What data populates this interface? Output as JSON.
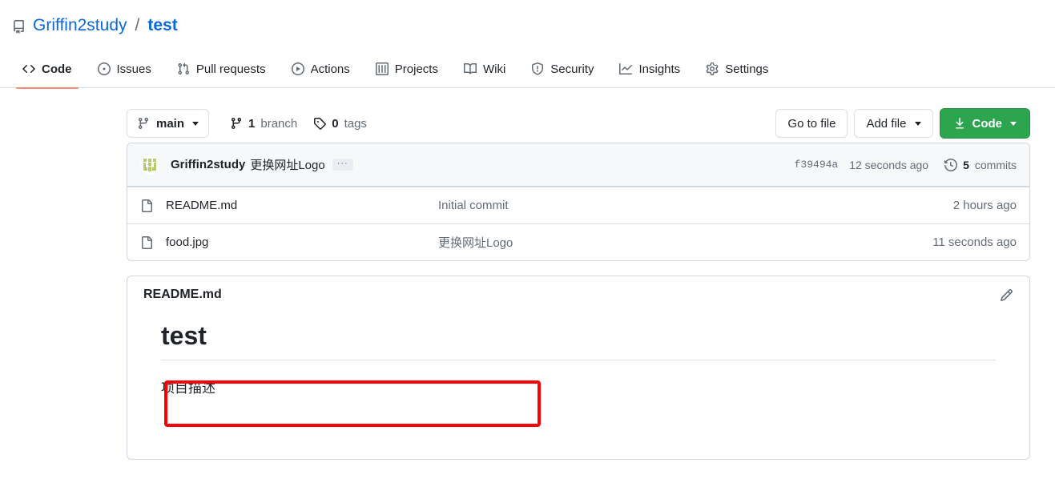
{
  "repo": {
    "icon": "repo-icon",
    "owner": "Griffin2study",
    "separator": "/",
    "name": "test"
  },
  "nav": {
    "tabs": [
      {
        "label": "Code",
        "icon": "code-icon",
        "active": true
      },
      {
        "label": "Issues",
        "icon": "issue-opened-icon",
        "active": false
      },
      {
        "label": "Pull requests",
        "icon": "git-pull-request-icon",
        "active": false
      },
      {
        "label": "Actions",
        "icon": "play-icon",
        "active": false
      },
      {
        "label": "Projects",
        "icon": "table-icon",
        "active": false
      },
      {
        "label": "Wiki",
        "icon": "book-icon",
        "active": false
      },
      {
        "label": "Security",
        "icon": "shield-icon",
        "active": false
      },
      {
        "label": "Insights",
        "icon": "graph-icon",
        "active": false
      },
      {
        "label": "Settings",
        "icon": "gear-icon",
        "active": false
      }
    ],
    "active_underline_color": "#fd8c73"
  },
  "toolbar": {
    "branch_selector": {
      "label": "main",
      "icon": "git-branch-icon"
    },
    "branch_count": {
      "value": "1",
      "label": "branch",
      "icon": "git-branch-icon"
    },
    "tag_count": {
      "value": "0",
      "label": "tags",
      "icon": "tag-icon"
    },
    "go_to_file": "Go to file",
    "add_file": "Add file",
    "code_button": {
      "label": "Code",
      "icon": "download-icon",
      "color": "#2da44e"
    }
  },
  "commit_bar": {
    "avatar": "user-avatar-identicon",
    "author": "Griffin2study",
    "message": "更换网址Logo",
    "expand_label": "···",
    "sha": "f39494a",
    "relative_time": "12 seconds ago",
    "commits_icon": "history-icon",
    "commits_count": "5",
    "commits_label": "commits"
  },
  "files": [
    {
      "icon": "file-icon",
      "name": "README.md",
      "message": "Initial commit",
      "time": "2 hours ago",
      "highlighted": false
    },
    {
      "icon": "file-icon",
      "name": "food.jpg",
      "message": "更换网址Logo",
      "time": "11 seconds ago",
      "highlighted": true
    }
  ],
  "annotation": {
    "color": "#fb0000",
    "target": "food.jpg-row"
  },
  "readme": {
    "title": "README.md",
    "edit_icon": "pencil-icon",
    "heading": "test",
    "paragraph": "项目描述"
  }
}
